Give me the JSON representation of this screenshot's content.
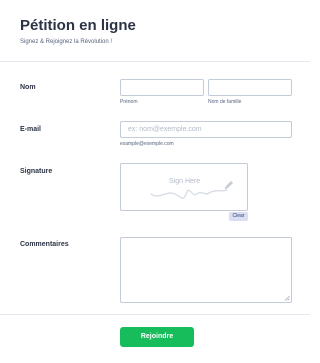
{
  "header": {
    "title": "Pétition en ligne",
    "subtitle": "Signez & Rejoignez la Révolution !"
  },
  "fields": {
    "name": {
      "label": "Nom",
      "first_placeholder": "",
      "last_placeholder": "",
      "first_sublabel": "Prénom",
      "last_sublabel": "Nom de famille"
    },
    "email": {
      "label": "E-mail",
      "placeholder": "ex: nom@exemple.com",
      "sublabel": "example@exemple.com"
    },
    "signature": {
      "label": "Signature",
      "hint": "Sign Here",
      "clear_label": "Clear"
    },
    "comments": {
      "label": "Commentaires",
      "value": ""
    }
  },
  "submit": {
    "label": "Rejoindre"
  },
  "colors": {
    "submit_bg": "#18bd5b",
    "clear_bg": "#dadef3",
    "input_border": "#c3cad8",
    "text": "#2c3345"
  },
  "icons": [
    "signature-scribble-icon",
    "pen-icon",
    "resize-grip-icon"
  ]
}
